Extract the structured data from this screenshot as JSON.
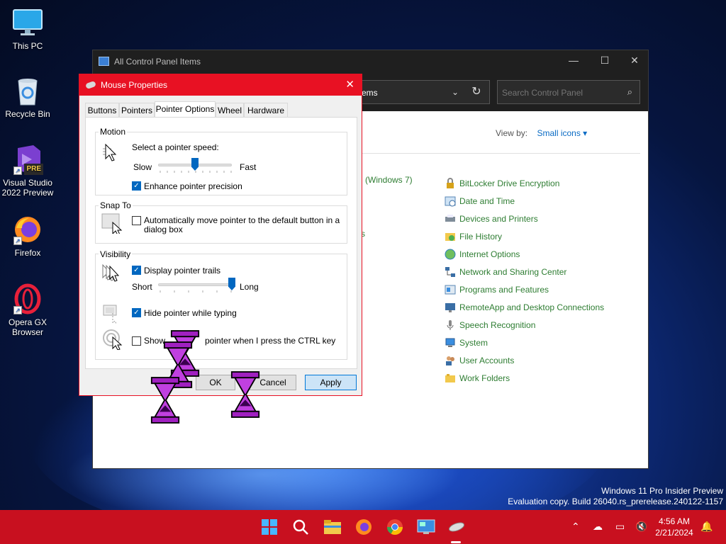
{
  "desktop": {
    "icons": [
      {
        "label": "This PC"
      },
      {
        "label": "Recycle Bin"
      },
      {
        "label": "Visual Studio 2022 Preview",
        "badge": "PRE"
      },
      {
        "label": "Firefox"
      },
      {
        "label": "Opera GX Browser"
      }
    ]
  },
  "control_panel": {
    "title": "All Control Panel Items",
    "address_tail": "ems",
    "search_placeholder": "Search Control Panel",
    "view_by_label": "View by:",
    "view_by_value": "Small icons",
    "partial_left_text": "(Windows 7)",
    "partial_left_text2": "s",
    "items": [
      {
        "label": "BitLocker Drive Encryption",
        "icon": "bitlocker-icon"
      },
      {
        "label": "Date and Time",
        "icon": "clock-icon"
      },
      {
        "label": "Devices and Printers",
        "icon": "printer-icon"
      },
      {
        "label": "File History",
        "icon": "file-history-icon"
      },
      {
        "label": "Internet Options",
        "icon": "globe-icon"
      },
      {
        "label": "Network and Sharing Center",
        "icon": "network-icon"
      },
      {
        "label": "Programs and Features",
        "icon": "programs-icon"
      },
      {
        "label": "RemoteApp and Desktop Connections",
        "icon": "remoteapp-icon"
      },
      {
        "label": "Speech Recognition",
        "icon": "microphone-icon"
      },
      {
        "label": "System",
        "icon": "system-icon"
      },
      {
        "label": "User Accounts",
        "icon": "users-icon"
      },
      {
        "label": "Work Folders",
        "icon": "folder-icon"
      }
    ]
  },
  "mouse_properties": {
    "title": "Mouse Properties",
    "tabs": [
      "Buttons",
      "Pointers",
      "Pointer Options",
      "Wheel",
      "Hardware"
    ],
    "active_tab": "Pointer Options",
    "motion": {
      "group": "Motion",
      "speed_label": "Select a pointer speed:",
      "slow": "Slow",
      "fast": "Fast",
      "speed_level": 0.5,
      "precision_label": "Enhance pointer precision",
      "precision_checked": true
    },
    "snap_to": {
      "group": "Snap To",
      "label_line1": "Automatically move pointer to the default button in a",
      "label_line2": "dialog box",
      "checked": false
    },
    "visibility": {
      "group": "Visibility",
      "trails_label": "Display pointer trails",
      "trails_checked": true,
      "short": "Short",
      "long": "Long",
      "trail_level": 1.0,
      "hide_label": "Hide pointer while typing",
      "hide_checked": true,
      "show_location_start": "Show",
      "show_location_end": "pointer when I press the CTRL key",
      "show_location_checked": false
    },
    "buttons": {
      "ok": "OK",
      "cancel": "Cancel",
      "apply": "Apply"
    }
  },
  "watermark": {
    "line1": "Windows 11 Pro Insider Preview",
    "line2": "Evaluation copy. Build 26040.rs_prerelease.240122-1157"
  },
  "taskbar": {
    "time": "4:56 AM",
    "date": "2/21/2024",
    "colors": {
      "taskbar": "#c8101f",
      "dialog_accent": "#e81123",
      "link_green": "#2e7d32"
    }
  }
}
